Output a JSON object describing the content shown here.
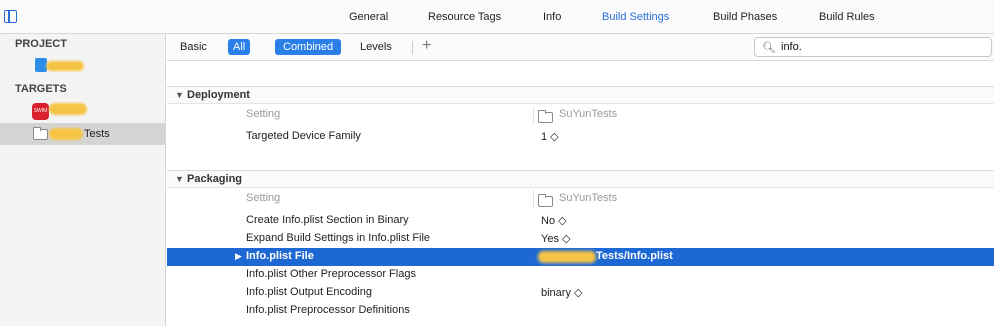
{
  "tabs": [
    {
      "label": "General",
      "active": false
    },
    {
      "label": "Resource Tags",
      "active": false
    },
    {
      "label": "Info",
      "active": false
    },
    {
      "label": "Build Settings",
      "active": true
    },
    {
      "label": "Build Phases",
      "active": false
    },
    {
      "label": "Build Rules",
      "active": false
    }
  ],
  "sidebar": {
    "project_heading": "PROJECT",
    "targets_heading": "TARGETS",
    "target_tests_suffix": "Tests",
    "app_icon_text": "SWIM"
  },
  "filterbar": {
    "basic": "Basic",
    "all": "All",
    "combined": "Combined",
    "levels": "Levels",
    "plus": "+",
    "search_value": "info."
  },
  "sections": [
    {
      "title": "Deployment",
      "column_setting": "Setting",
      "column_target": "SuYunTests",
      "rows": [
        {
          "name": "Targeted Device Family",
          "value": "1 ◇"
        }
      ]
    },
    {
      "title": "Packaging",
      "column_setting": "Setting",
      "column_target": "SuYunTests",
      "rows": [
        {
          "name": "Create Info.plist Section in Binary",
          "value": "No ◇"
        },
        {
          "name": "Expand Build Settings in Info.plist File",
          "value": "Yes ◇"
        },
        {
          "name": "Info.plist File",
          "value": "Tests/Info.plist",
          "selected": true
        },
        {
          "name": "Info.plist Other Preprocessor Flags",
          "value": ""
        },
        {
          "name": "Info.plist Output Encoding",
          "value": "binary ◇"
        },
        {
          "name": "Info.plist Preprocessor Definitions",
          "value": ""
        }
      ]
    }
  ],
  "colors": {
    "accent": "#2a6edc",
    "selected_row": "#1e68d3",
    "redaction": "#f6c445"
  }
}
